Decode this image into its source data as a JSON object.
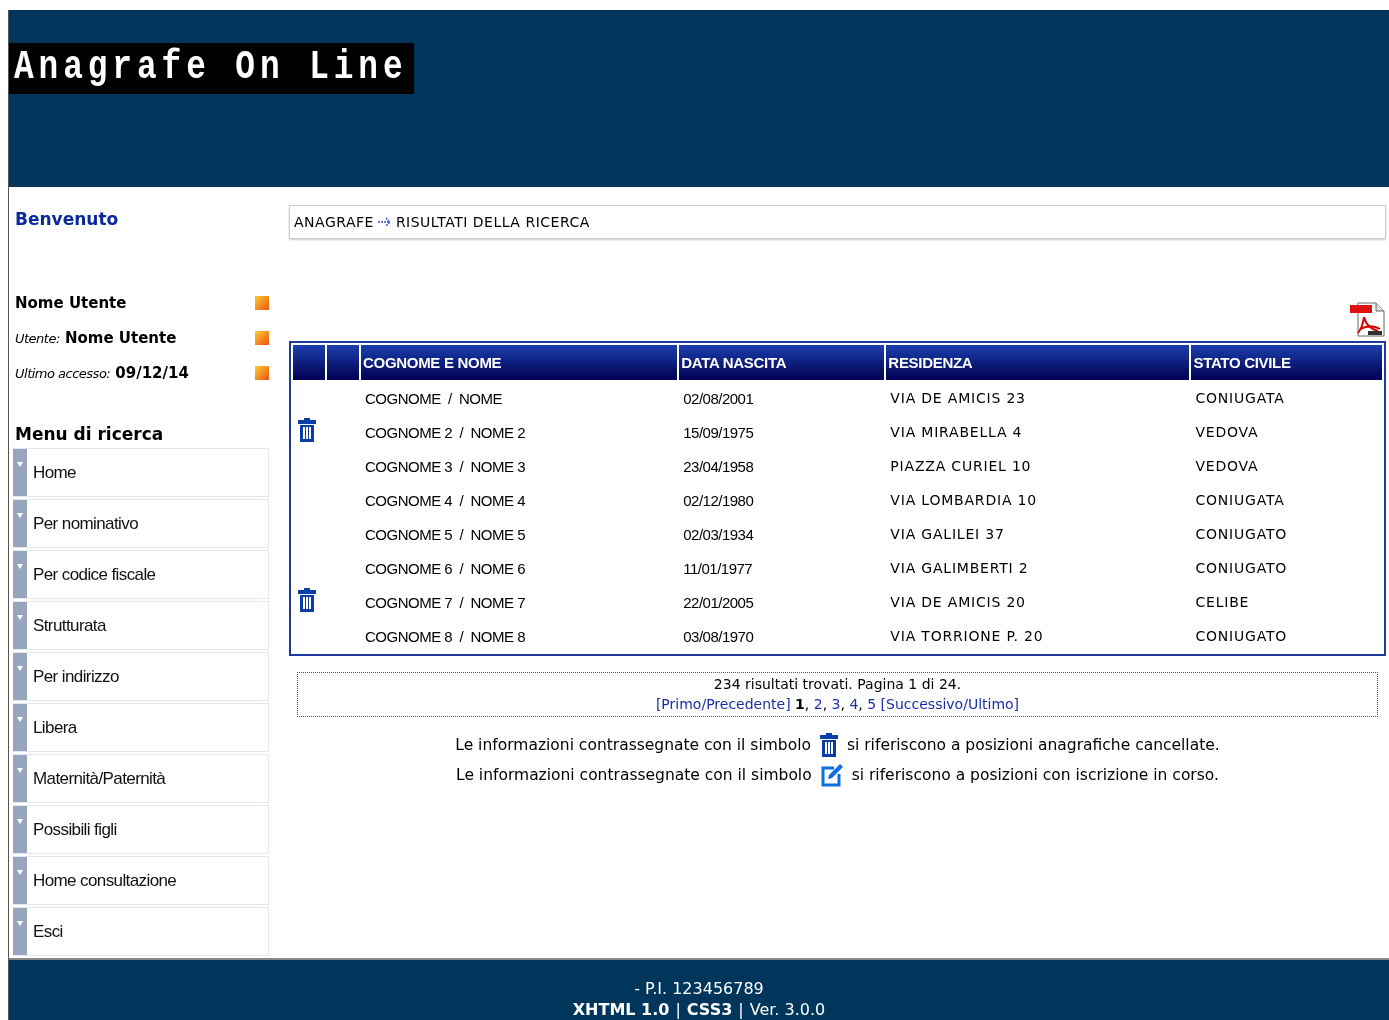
{
  "header": {
    "logo": "Anagrafe On Line"
  },
  "sidebar": {
    "welcome": "Benvenuto",
    "user_info": [
      {
        "value": "Nome Utente"
      },
      {
        "label": "Utente:",
        "value": "Nome Utente"
      },
      {
        "label": "Ultimo accesso:",
        "value": "09/12/14"
      }
    ],
    "menu_title": "Menu di ricerca",
    "menu": [
      "Home",
      "Per nominativo",
      "Per codice fiscale",
      "Strutturata",
      "Per indirizzo",
      "Libera",
      "Maternità/Paternità",
      "Possibili figli",
      "Home consultazione",
      "Esci"
    ]
  },
  "breadcrumb": [
    "ANAGRAFE",
    "RISULTATI DELLA RICERCA"
  ],
  "table": {
    "columns": [
      "",
      "",
      "COGNOME E NOME",
      "DATA NASCITA",
      "RESIDENZA",
      "STATO CIVILE"
    ],
    "rows": [
      {
        "deleted": false,
        "name": "COGNOME  /  NOME",
        "birth": "02/08/2001",
        "address": "VIA DE AMICIS 23",
        "status": "CONIUGATA"
      },
      {
        "deleted": true,
        "name": "COGNOME 2  /  NOME 2",
        "birth": "15/09/1975",
        "address": "VIA MIRABELLA 4",
        "status": "VEDOVA"
      },
      {
        "deleted": false,
        "name": "COGNOME 3  /  NOME 3",
        "birth": "23/04/1958",
        "address": "PIAZZA CURIEL 10",
        "status": "VEDOVA"
      },
      {
        "deleted": false,
        "name": "COGNOME 4  /  NOME 4",
        "birth": "02/12/1980",
        "address": "VIA LOMBARDIA 10",
        "status": "CONIUGATA"
      },
      {
        "deleted": false,
        "name": "COGNOME 5  /  NOME 5",
        "birth": "02/03/1934",
        "address": "VIA GALILEI 37",
        "status": "CONIUGATO"
      },
      {
        "deleted": false,
        "name": "COGNOME 6  /  NOME 6",
        "birth": "11/01/1977",
        "address": "VIA GALIMBERTI 2",
        "status": "CONIUGATO"
      },
      {
        "deleted": true,
        "name": "COGNOME 7  /  NOME 7",
        "birth": "22/01/2005",
        "address": "VIA DE AMICIS 20",
        "status": "CELIBE"
      },
      {
        "deleted": false,
        "name": "COGNOME 8  /  NOME 8",
        "birth": "03/08/1970",
        "address": "VIA TORRIONE P. 20",
        "status": "CONIUGATO"
      }
    ]
  },
  "pager": {
    "summary": "234 risultati trovati. Pagina 1 di 24.",
    "first": "[Primo/Precedente]",
    "separator": ",",
    "pages": [
      {
        "label": "1",
        "selected": true
      },
      {
        "label": "2",
        "selected": false
      },
      {
        "label": "3",
        "selected": false
      },
      {
        "label": "4",
        "selected": false
      },
      {
        "label": "5",
        "selected": false
      }
    ],
    "last": "[Successivo/Ultimo]"
  },
  "legend": [
    {
      "kind": "trash",
      "before": "Le informazioni contrassegnate con il simbolo",
      "after": "si riferiscono a posizioni anagrafiche cancellate."
    },
    {
      "kind": "edit",
      "before": "Le informazioni contrassegnate con il simbolo",
      "after": "si riferiscono a posizioni con iscrizione in corso."
    }
  ],
  "footer": {
    "line": "- P.I. 123456789",
    "items": [
      {
        "text": "XHTML 1.0",
        "bold": true
      },
      {
        "text": "|",
        "bold": false
      },
      {
        "text": "CSS3",
        "bold": true
      },
      {
        "text": "|",
        "bold": false
      },
      {
        "text": "Ver. 3.0.0",
        "bold": false
      }
    ]
  }
}
